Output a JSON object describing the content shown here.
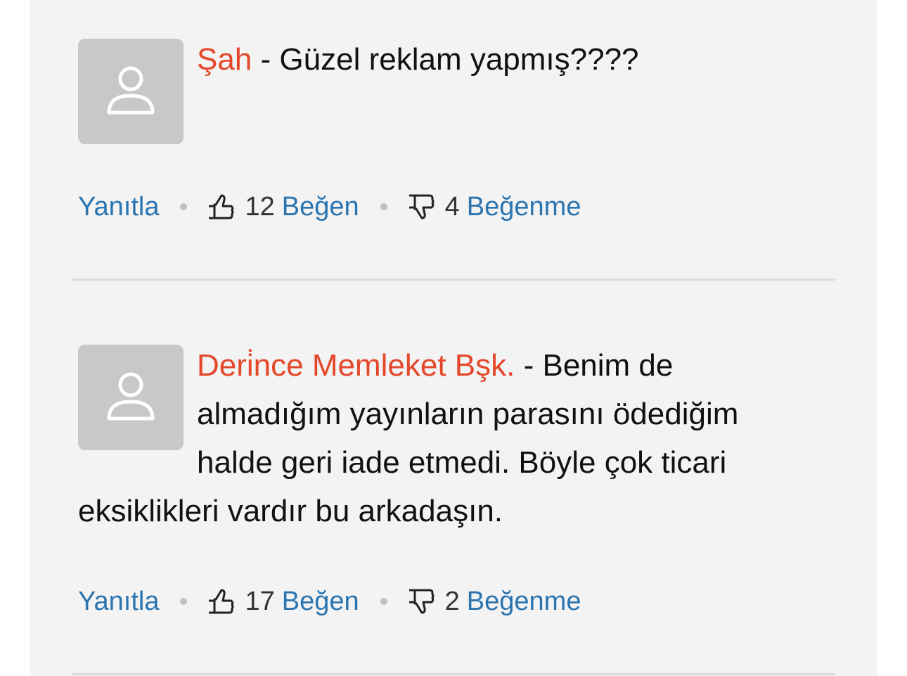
{
  "comments": [
    {
      "author": "Şah",
      "separator": " - ",
      "text": "Güzel reklam yapmış????",
      "reply_label": "Yanıtla",
      "like_count": "12",
      "like_label": "Beğen",
      "dislike_count": "4",
      "dislike_label": "Beğenme"
    },
    {
      "author": "Deri̇nce Memleket Bşk.",
      "separator": " - ",
      "text": "Benim de almadığım yayınların parasını ödediğim halde geri iade etmedi. Böyle çok ticari eksiklikleri vardır bu arkadaşın.",
      "reply_label": "Yanıtla",
      "like_count": "17",
      "like_label": "Beğen",
      "dislike_count": "2",
      "dislike_label": "Beğenme"
    }
  ],
  "icons": {
    "avatar": "user-icon",
    "like": "thumbs-up-icon",
    "dislike": "thumbs-down-icon"
  },
  "colors": {
    "author": "#e5472a",
    "link": "#2a74b0",
    "background": "#f3f3f3",
    "avatar_bg": "#c8c8c8"
  }
}
